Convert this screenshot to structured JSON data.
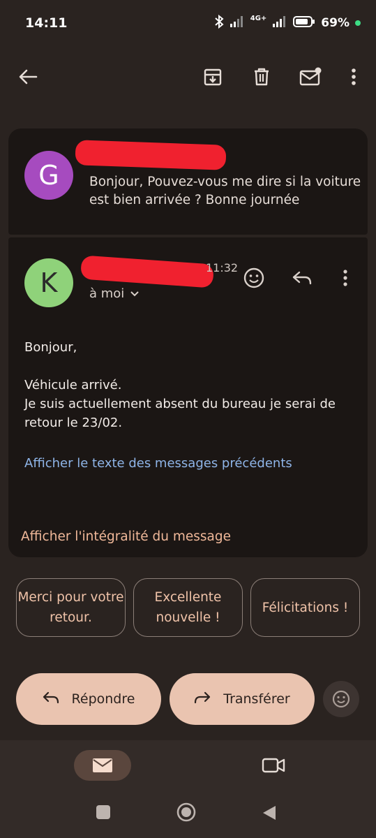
{
  "status": {
    "time": "14:11",
    "network": "4G+",
    "battery": "69%"
  },
  "toolbar": {
    "back": "back-arrow",
    "archive": "archive",
    "delete": "delete",
    "mark_unread": "mark-unread",
    "more": "more"
  },
  "thread": [
    {
      "avatar_letter": "G",
      "avatar_color": "#a64bbf",
      "snippet": "Bonjour, Pouvez-vous me dire si la voiture est bien arrivée ? Bonne journée"
    },
    {
      "avatar_letter": "K",
      "avatar_color": "#8fd27a",
      "time_fragment": "11:32",
      "recipient": "à moi",
      "body": {
        "greeting": "Bonjour,",
        "line1": "Véhicule arrivé.",
        "line2": "Je suis actuellement absent du bureau je serai de retour le 23/02."
      },
      "show_previous": "Afficher le texte des messages précédents",
      "show_full": "Afficher l'intégralité du message"
    }
  ],
  "smart_replies": [
    "Merci pour votre retour.",
    "Excellente nouvelle !",
    "Félicitations !"
  ],
  "actions": {
    "reply": "Répondre",
    "forward": "Transférer"
  },
  "colors": {
    "accent": "#eac4b0",
    "link": "#8fb5e8",
    "chip_text": "#f0c3a9",
    "redaction": "#f0212f"
  }
}
